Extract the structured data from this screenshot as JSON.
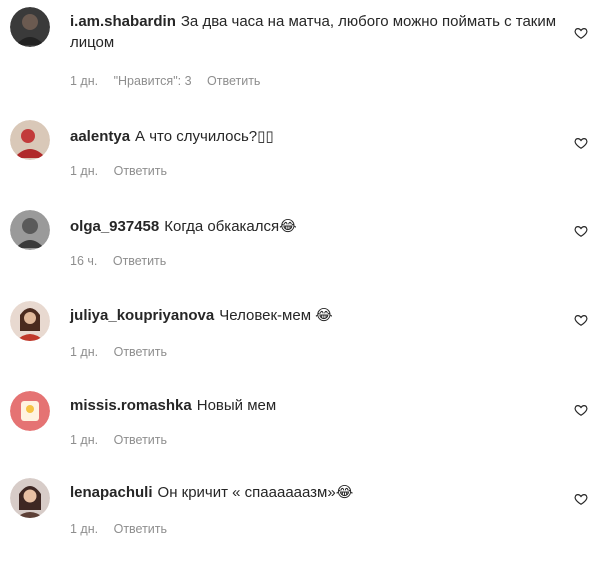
{
  "comments": [
    {
      "username": "i.am.shabardin",
      "text": "За два часа на матча, любого можно поймать с таким лицом",
      "time": "1 дн.",
      "likes": "\"Нравится\": 3",
      "reply": "Ответить"
    },
    {
      "username": "aalentya",
      "text": "А что случилось?▯▯",
      "time": "1 дн.",
      "reply": "Ответить"
    },
    {
      "username": "olga_937458",
      "text": "Когда обкакался😂",
      "time": "16 ч.",
      "reply": "Ответить"
    },
    {
      "username": "juliya_koupriyanova",
      "text": "Человек-мем 😂",
      "time": "1 дн.",
      "reply": "Ответить"
    },
    {
      "username": "missis.romashka",
      "text": "Новый мем",
      "time": "1 дн.",
      "reply": "Ответить"
    },
    {
      "username": "lenapachuli",
      "text": "Он кричит « спаааааазм»😂",
      "time": "1 дн.",
      "reply": "Ответить"
    }
  ],
  "icons": {
    "like": "heart-outline-icon"
  },
  "colors": {
    "text": "#262626",
    "meta": "#8e8e8e"
  }
}
